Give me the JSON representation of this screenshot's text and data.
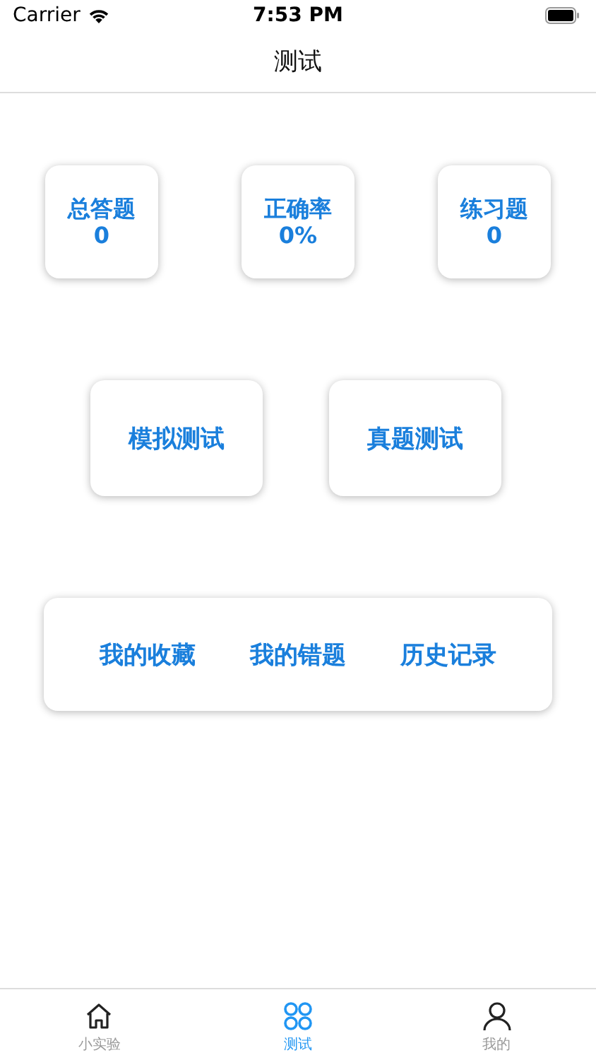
{
  "status_bar": {
    "carrier": "Carrier",
    "time": "7:53 PM"
  },
  "nav": {
    "title": "测试"
  },
  "stats": [
    {
      "label": "总答题",
      "value": "0"
    },
    {
      "label": "正确率",
      "value": "0%"
    },
    {
      "label": "练习题",
      "value": "0"
    }
  ],
  "modes": [
    "模拟测试",
    "真题测试"
  ],
  "links": [
    "我的收藏",
    "我的错题",
    "历史记录"
  ],
  "tabs": [
    {
      "label": "小实验",
      "kind": "home",
      "selected": false
    },
    {
      "label": "测试",
      "kind": "grid",
      "selected": true
    },
    {
      "label": "我的",
      "kind": "person",
      "selected": false
    }
  ]
}
